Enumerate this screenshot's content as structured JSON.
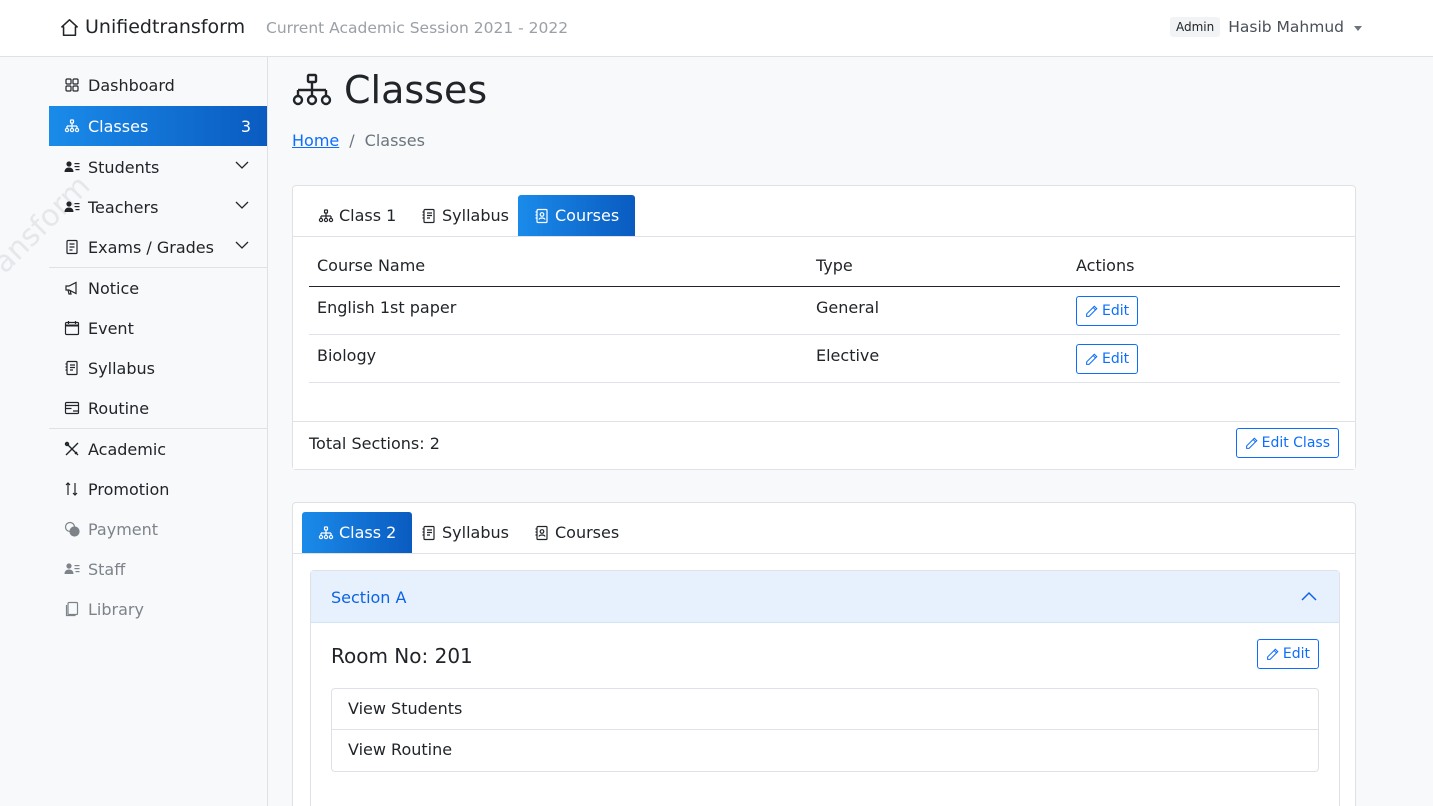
{
  "navbar": {
    "brand": "Unifiedtransform",
    "session": "Current Academic Session 2021 - 2022",
    "role_badge": "Admin",
    "user_name": "Hasib Mahmud"
  },
  "sidebar": {
    "watermark": "ansform",
    "items": [
      {
        "label": "Dashboard",
        "icon": "grid-icon"
      },
      {
        "label": "Classes",
        "icon": "hierarchy-icon",
        "count": "3",
        "active": true
      },
      {
        "label": "Students",
        "icon": "person-lines-icon",
        "expandable": true
      },
      {
        "label": "Teachers",
        "icon": "person-lines-icon",
        "expandable": true
      },
      {
        "label": "Exams / Grades",
        "icon": "file-text-icon",
        "expandable": true
      },
      {
        "label": "Notice",
        "icon": "megaphone-icon"
      },
      {
        "label": "Event",
        "icon": "calendar-icon"
      },
      {
        "label": "Syllabus",
        "icon": "journal-text-icon"
      },
      {
        "label": "Routine",
        "icon": "calendar-range-icon"
      },
      {
        "label": "Academic",
        "icon": "tools-icon"
      },
      {
        "label": "Promotion",
        "icon": "sort-arrows-icon"
      },
      {
        "label": "Payment",
        "icon": "coins-icon",
        "disabled": true
      },
      {
        "label": "Staff",
        "icon": "person-lines-icon",
        "disabled": true
      },
      {
        "label": "Library",
        "icon": "journals-icon",
        "disabled": true
      }
    ]
  },
  "page": {
    "title": "Classes",
    "breadcrumb": {
      "home": "Home",
      "separator": "/",
      "current": "Classes"
    }
  },
  "class_cards": [
    {
      "tabs": [
        "Class 1",
        "Syllabus",
        "Courses"
      ],
      "active_tab": "Courses",
      "table": {
        "headers": [
          "Course Name",
          "Type",
          "Actions"
        ],
        "rows": [
          {
            "name": "English 1st paper",
            "type": "General",
            "action": "Edit"
          },
          {
            "name": "Biology",
            "type": "Elective",
            "action": "Edit"
          }
        ]
      },
      "footer": {
        "total_sections": "Total Sections: 2",
        "edit_button": "Edit Class"
      }
    },
    {
      "tabs": [
        "Class 2",
        "Syllabus",
        "Courses"
      ],
      "active_tab": "Class 2",
      "section": {
        "title": "Section A",
        "room": "Room No: 201",
        "edit_button": "Edit",
        "links": [
          "View Students",
          "View Routine"
        ]
      }
    }
  ],
  "colors": {
    "primary": "#0d6efd",
    "active_gradient_start": "#1a8bea",
    "active_gradient_end": "#0a5bc0",
    "accordion_bg": "#e7f1fe"
  }
}
